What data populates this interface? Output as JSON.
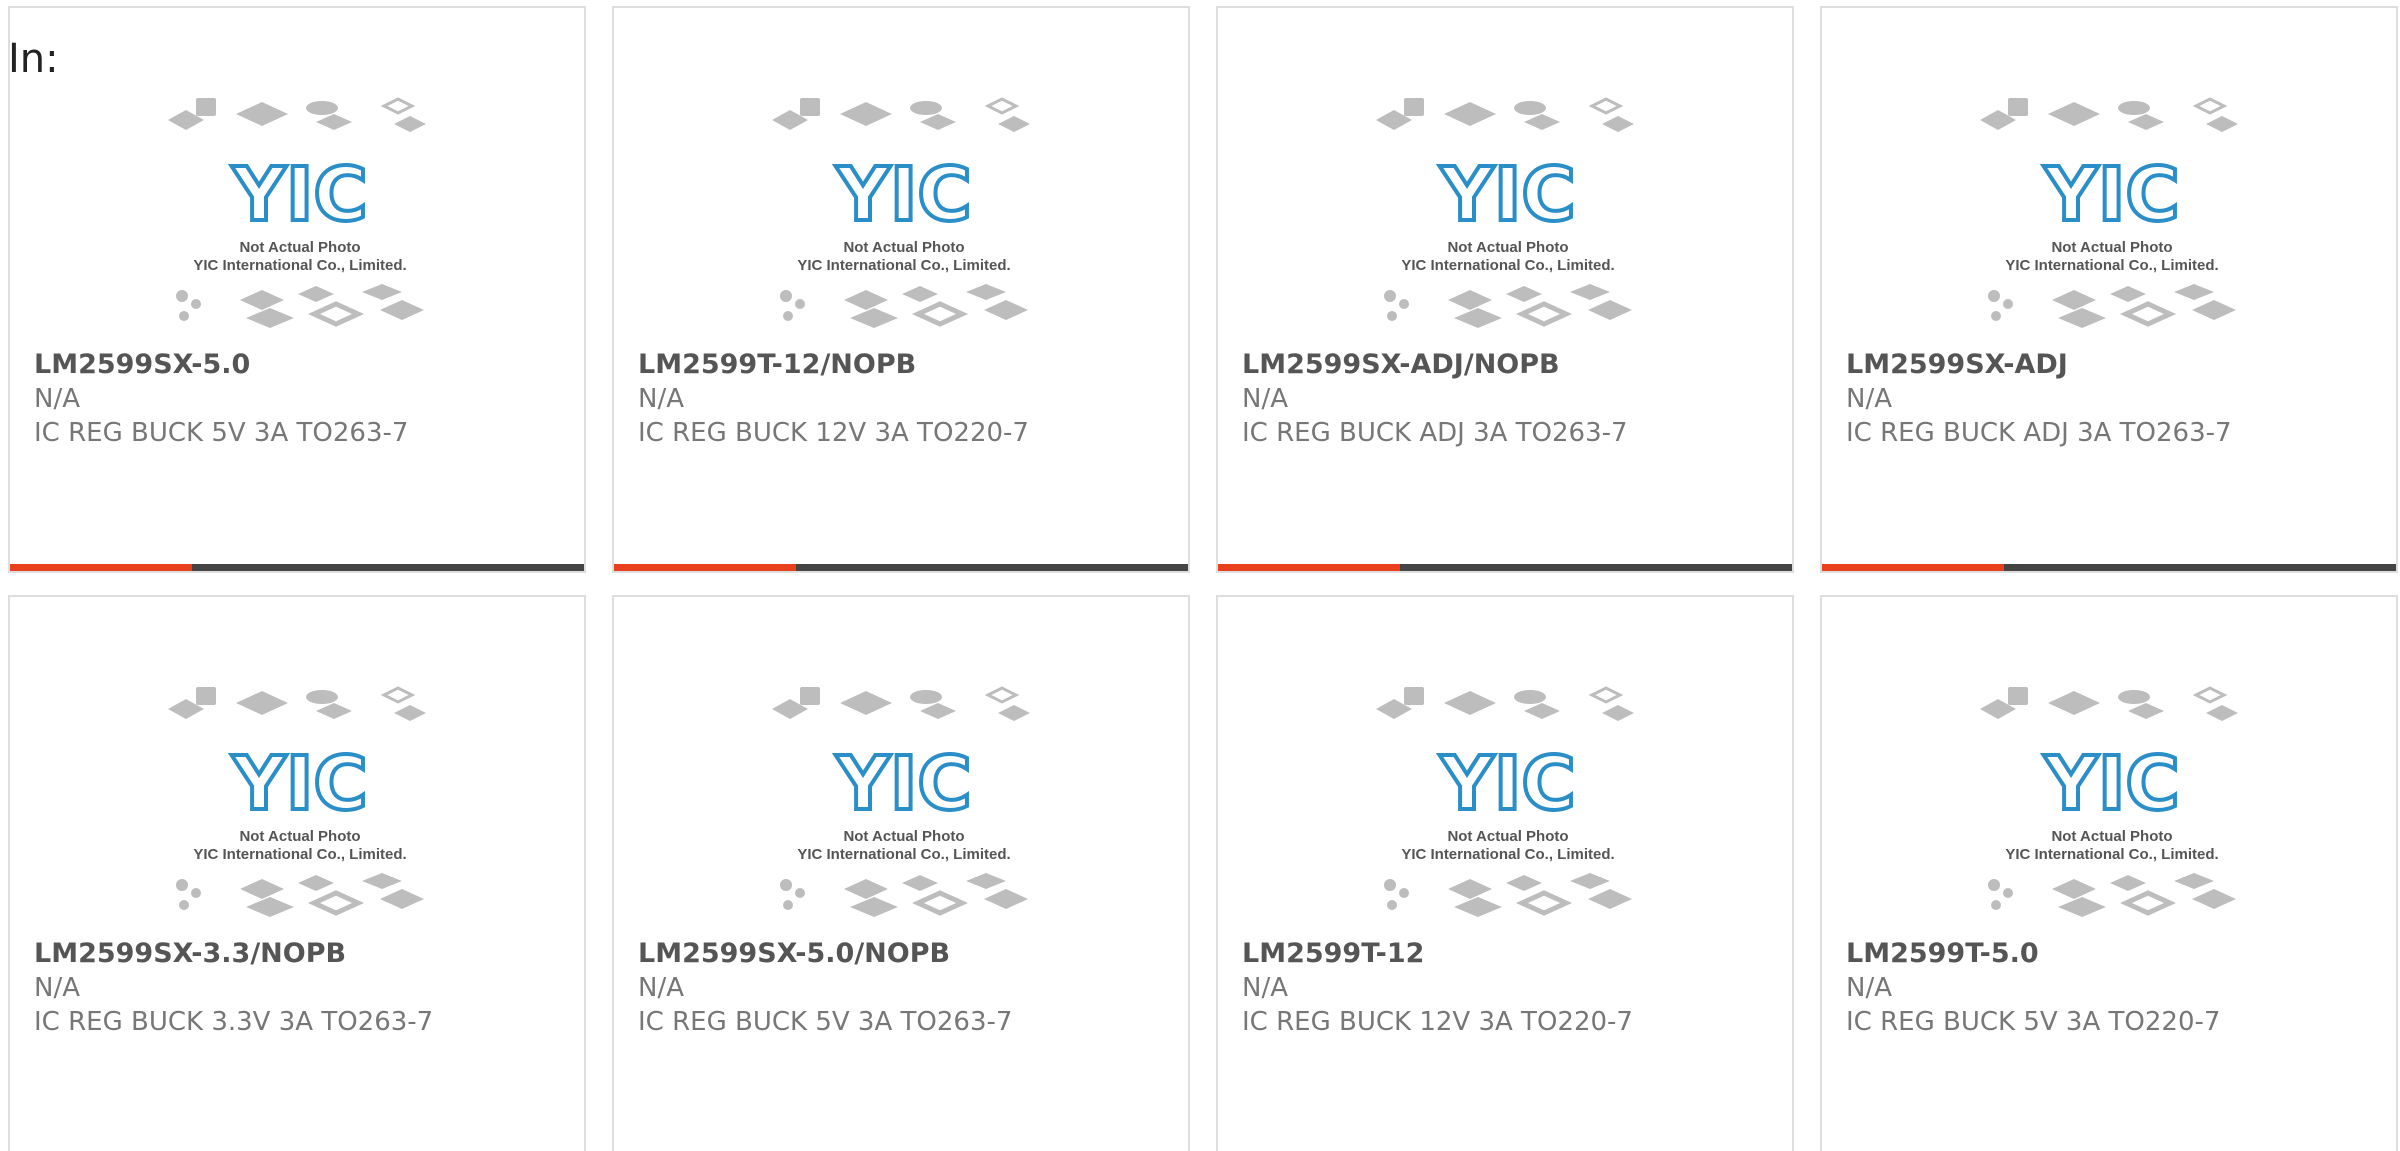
{
  "header": {
    "label": "In:"
  },
  "theme": {
    "accent": "#e8401c",
    "bar": "#444444",
    "chip": "#bdbdbd",
    "logo": "#2a8ec8"
  },
  "placeholder": {
    "logo_text": "YIC",
    "line1": "Not Actual Photo",
    "line2": "YIC International Co., Limited."
  },
  "products": [
    {
      "part": "LM2599SX-5.0",
      "mfr": "N/A",
      "desc": "IC REG BUCK 5V 3A TO263-7"
    },
    {
      "part": "LM2599T-12/NOPB",
      "mfr": "N/A",
      "desc": "IC REG BUCK 12V 3A TO220-7"
    },
    {
      "part": "LM2599SX-ADJ/NOPB",
      "mfr": "N/A",
      "desc": "IC REG BUCK ADJ 3A TO263-7"
    },
    {
      "part": "LM2599SX-ADJ",
      "mfr": "N/A",
      "desc": "IC REG BUCK ADJ 3A TO263-7"
    },
    {
      "part": "LM2599SX-3.3/NOPB",
      "mfr": "N/A",
      "desc": "IC REG BUCK 3.3V 3A TO263-7"
    },
    {
      "part": "LM2599SX-5.0/NOPB",
      "mfr": "N/A",
      "desc": "IC REG BUCK 5V 3A TO263-7"
    },
    {
      "part": "LM2599T-12",
      "mfr": "N/A",
      "desc": "IC REG BUCK 12V 3A TO220-7"
    },
    {
      "part": "LM2599T-5.0",
      "mfr": "N/A",
      "desc": "IC REG BUCK 5V 3A TO220-7"
    }
  ]
}
